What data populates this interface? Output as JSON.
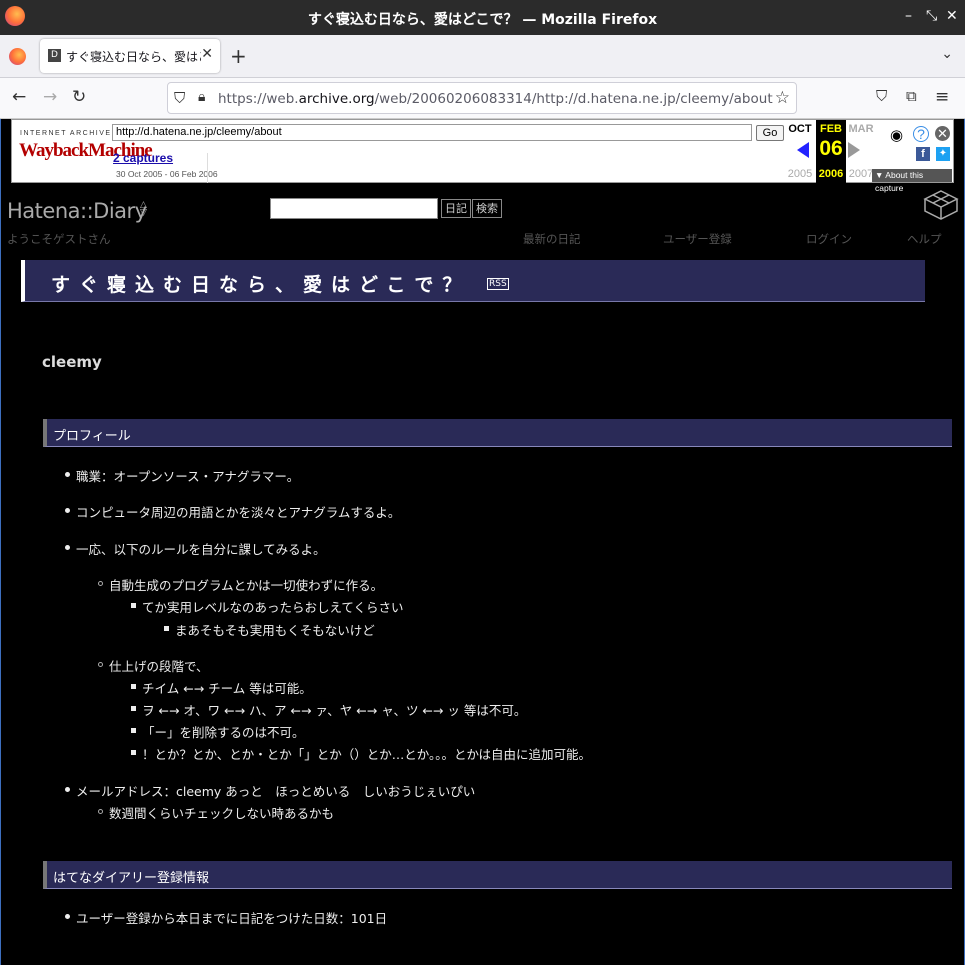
{
  "window": {
    "title": "すぐ寝込む日なら、愛はどこで？ — Mozilla Firefox"
  },
  "tab": {
    "favicon": "D",
    "label": "すぐ寝込む日なら、愛はどこ"
  },
  "url": {
    "prefix": "https://web.",
    "domain": "archive.org",
    "path": "/web/20060206083314/http://d.hatena.ne.jp/cleemy/about"
  },
  "wayback": {
    "ia_label": "INTERNET ARCHIVE",
    "logo": "WaybackMachine",
    "url_value": "http://d.hatena.ne.jp/cleemy/about",
    "go_label": "Go",
    "captures": "2 captures",
    "range": "30 Oct 2005 - 06 Feb 2006",
    "prev_month": "OCT",
    "prev_year": "2005",
    "cur_month": "FEB",
    "cur_day": "06",
    "cur_year": "2006",
    "next_month": "MAR",
    "next_year": "2007",
    "about": "▼ About this capture"
  },
  "hatena": {
    "logo": "Hatena::Diary",
    "diary_btn": "日記",
    "search_btn": "検索",
    "welcome": "ようこそゲストさん",
    "nav": [
      "最新の日記",
      "ユーザー登録",
      "ログイン",
      "ヘルプ"
    ]
  },
  "blog": {
    "title": "すぐ寝込む日なら、愛はどこで？",
    "rss": "RSS",
    "username": "cleemy"
  },
  "profile": {
    "heading": "プロフィール",
    "items": [
      "職業：オープンソース・アナグラマー。",
      "コンピュータ周辺の用語とかを淡々とアナグラムするよ。",
      "一応、以下のルールを自分に課してみるよ。",
      "自動生成のプログラムとかは一切使わずに作る。",
      "てか実用レベルなのあったらおしえてくらさい",
      "まあそもそも実用もくそもないけど",
      "仕上げの段階で、",
      "チイム ←→ チーム 等は可能。",
      "ヲ ←→ オ、ワ ←→ ハ、ア ←→ ァ、ヤ ←→ ャ、ツ ←→ ッ 等は不可。",
      "「ー」を削除するのは不可。",
      "！とか？とか、とか・とか「」とか（）とか…とか。。。とかは自由に追加可能。",
      "メールアドレス：cleemy あっと　ほっとめいる　しいおうじぇいぴい",
      "数週間くらいチェックしない時あるかも"
    ]
  },
  "registration": {
    "heading": "はてなダイアリー登録情報",
    "items": [
      "ユーザー登録から本日までに日記をつけた日数：101日"
    ]
  }
}
